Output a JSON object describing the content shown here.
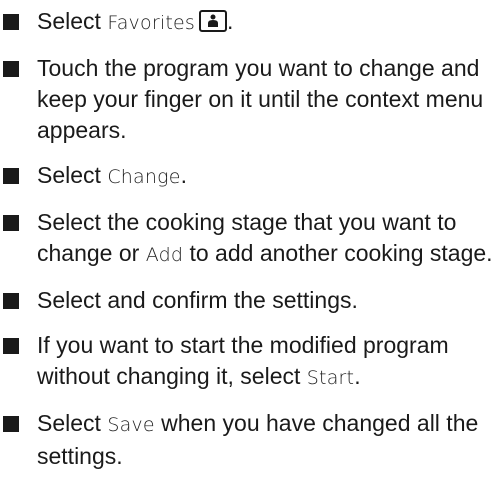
{
  "steps": [
    {
      "pre": "Select ",
      "ui": "Favorites",
      "icon": "favorites-icon",
      "post": "."
    },
    {
      "text": "Touch the program you want to change and keep your finger on it until the context menu appears."
    },
    {
      "pre": "Select ",
      "ui": "Change",
      "post": "."
    },
    {
      "pre": "Select the cooking stage that you want to change or ",
      "ui": "Add",
      "post": " to add another cooking stage."
    },
    {
      "text": "Select and confirm the settings."
    },
    {
      "pre": "If you want to start the modified program without changing it, select ",
      "ui": "Start",
      "post": "."
    },
    {
      "pre": "Select ",
      "ui": "Save",
      "post": " when you have changed all the settings."
    }
  ]
}
